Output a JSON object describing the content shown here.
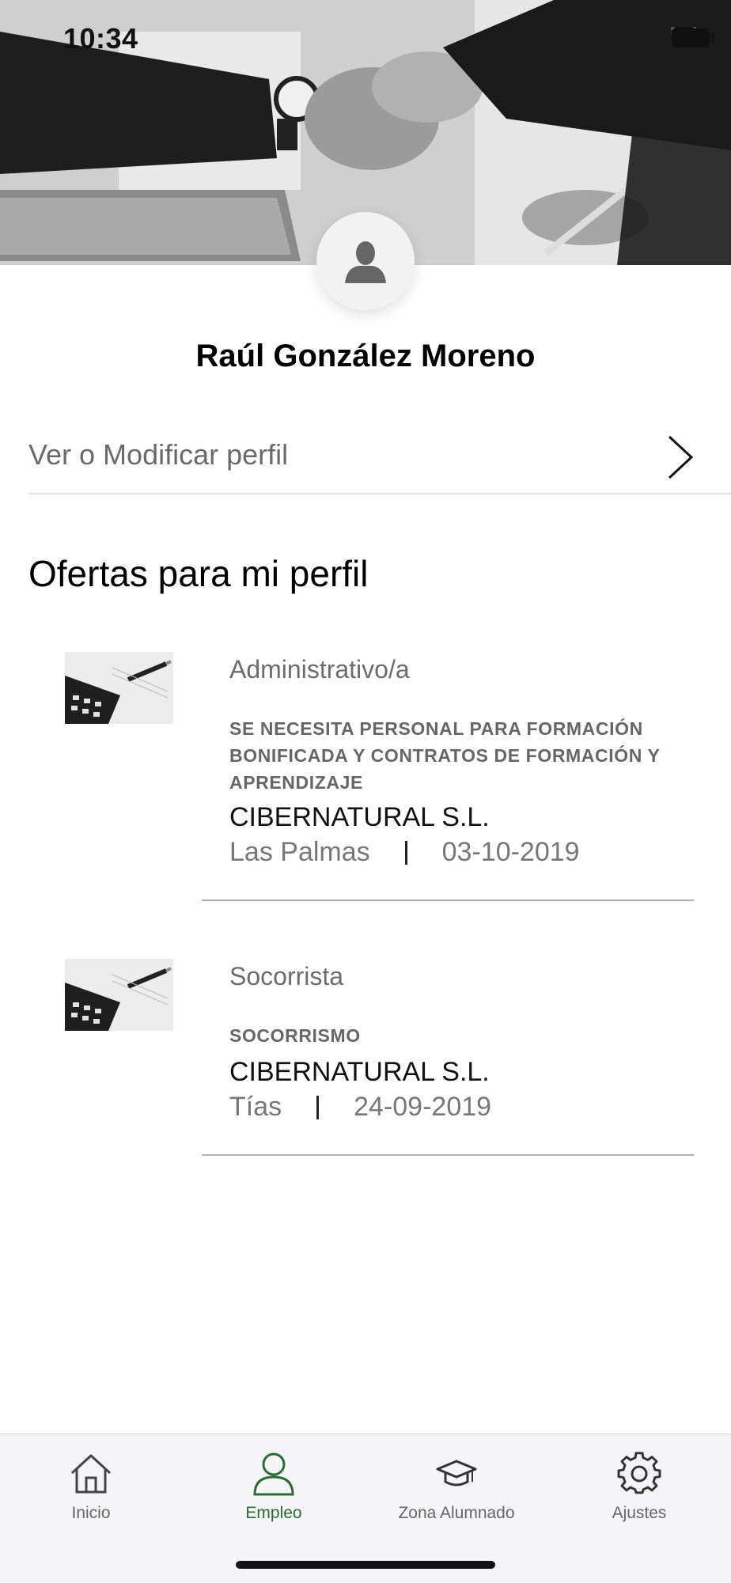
{
  "status_bar": {
    "time": "10:34"
  },
  "profile": {
    "name": "Raúl González Moreno",
    "edit_link": "Ver o Modificar perfil"
  },
  "offers_section": {
    "title": "Ofertas para mi perfil",
    "items": [
      {
        "role": "Administrativo/a",
        "description": "SE NECESITA PERSONAL PARA FORMACIÓN BONIFICADA Y CONTRATOS DE FORMACIÓN Y APRENDIZAJE",
        "company": "CIBERNATURAL S.L.",
        "location": "Las Palmas",
        "date": "03-10-2019"
      },
      {
        "role": "Socorrista",
        "description": "SOCORRISMO",
        "company": "CIBERNATURAL S.L.",
        "location": "Tías",
        "date": "24-09-2019"
      }
    ]
  },
  "tabbar": {
    "items": [
      {
        "label": "Inicio",
        "icon": "home-icon"
      },
      {
        "label": "Empleo",
        "icon": "person-icon",
        "active": true
      },
      {
        "label": "Zona Alumnado",
        "icon": "graduation-cap-icon"
      },
      {
        "label": "Ajustes",
        "icon": "gear-icon"
      }
    ],
    "active_color": "#2d6a36"
  }
}
